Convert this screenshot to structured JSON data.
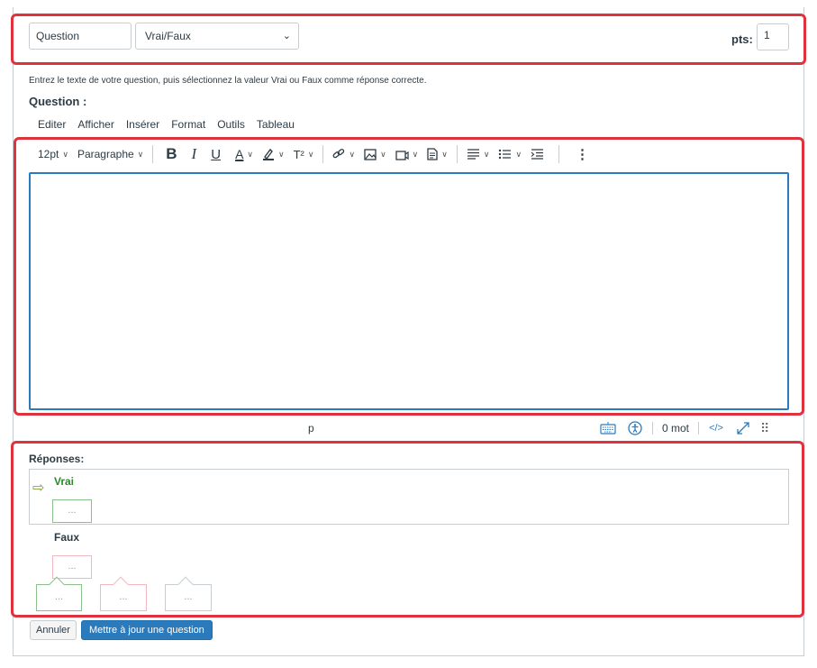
{
  "header": {
    "question_name": "Question",
    "question_type": "Vrai/Faux",
    "points_label": "pts:",
    "points_value": "1"
  },
  "instructions": "Entrez le texte de votre question, puis sélectionnez la valeur Vrai ou Faux comme réponse correcte.",
  "question_label": "Question :",
  "editor": {
    "menu": [
      "Editer",
      "Afficher",
      "Insérer",
      "Format",
      "Outils",
      "Tableau"
    ],
    "font_size": "12pt",
    "block_format": "Paragraphe",
    "bold": "B",
    "italic": "I",
    "underline": "U",
    "text_color": "A",
    "superscript": "T²",
    "more": "⋮",
    "path": "p",
    "word_count": "0 mot",
    "html_toggle": "</>"
  },
  "answers": {
    "label": "Réponses:",
    "true_label": "Vrai",
    "false_label": "Faux",
    "comment_placeholder": "..."
  },
  "buttons": {
    "cancel": "Annuler",
    "update": "Mettre à jour une question"
  },
  "colors": {
    "highlight": "#e0323c",
    "primary": "#2b7abc",
    "correct": "#2b8a2b"
  }
}
